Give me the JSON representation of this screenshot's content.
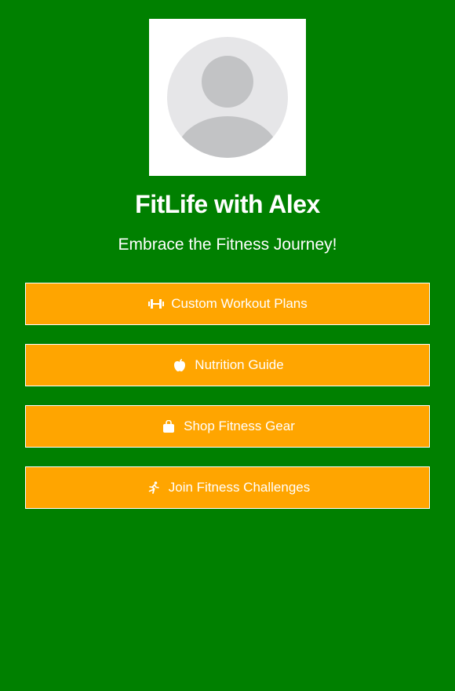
{
  "profile": {
    "title": "FitLife with Alex",
    "subtitle": "Embrace the Fitness Journey!"
  },
  "colors": {
    "background": "#008000",
    "button": "#ffa500",
    "text": "#ffffff"
  },
  "links": [
    {
      "label": "Custom Workout Plans",
      "icon": "dumbbell-icon"
    },
    {
      "label": "Nutrition Guide",
      "icon": "apple-icon"
    },
    {
      "label": "Shop Fitness Gear",
      "icon": "shopping-bag-icon"
    },
    {
      "label": "Join Fitness Challenges",
      "icon": "running-icon"
    }
  ]
}
